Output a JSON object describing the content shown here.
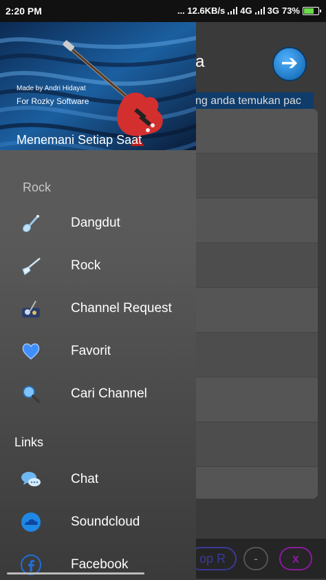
{
  "status_bar": {
    "time": "2:20 PM",
    "right_text": "... 12.6KB/s",
    "net1": "4G",
    "net2": "3G",
    "battery": "73%",
    "battery_level": 0.73
  },
  "background": {
    "title_fragment": "a",
    "marquee_text": "ng anda temukan pac",
    "stop_label": "op R",
    "minus_label": "-",
    "close_label": "x"
  },
  "drawer": {
    "header": {
      "made_by": "Made by Andri Hidayat",
      "for": "For Rozky Software",
      "tagline": "Menemani Setiap Saat"
    },
    "sections": {
      "rock": "Rock",
      "links": "Links"
    },
    "items": [
      {
        "label": "Dangdut",
        "icon": "guitar-icon"
      },
      {
        "label": "Rock",
        "icon": "electric-guitar-icon"
      },
      {
        "label": "Channel Request",
        "icon": "band-icon"
      },
      {
        "label": "Favorit",
        "icon": "heart-icon"
      },
      {
        "label": "Cari Channel",
        "icon": "search-icon"
      }
    ],
    "links": [
      {
        "label": "Chat",
        "icon": "chat-icon"
      },
      {
        "label": "Soundcloud",
        "icon": "soundcloud-icon"
      },
      {
        "label": "Facebook",
        "icon": "facebook-icon"
      }
    ]
  },
  "colors": {
    "accent": "#1e88e5",
    "guitar_red": "#d32f2f",
    "drawer_bg": "#5a5a5a"
  }
}
